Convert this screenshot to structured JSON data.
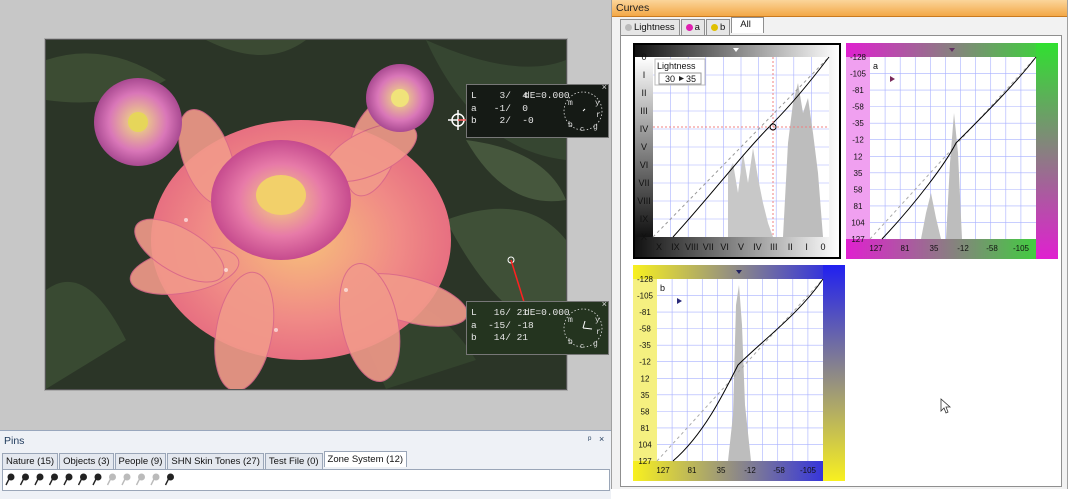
{
  "readouts": [
    {
      "L": "L    3/  4",
      "a": "a   -1/  0",
      "b": "b    2/  -0",
      "dE": "dE=0.000",
      "close": "×"
    },
    {
      "L": "L   16/ 21",
      "a": "a  -15/ -18",
      "b": "b   14/ 21",
      "dE": "dE=0.000",
      "close": "×"
    }
  ],
  "dial_labels": {
    "m": "m",
    "y": "y",
    "r": "r",
    "g": "g",
    "b": "b",
    "c": "c"
  },
  "pins": {
    "title": "Pins",
    "pin_control": "ᵖ",
    "close_control": "×",
    "tabs": [
      "Nature (15)",
      "Objects (3)",
      "People (9)",
      "SHN Skin Tones (27)",
      "Test File (0)",
      "Zone System (12)"
    ],
    "active_tab": 5
  },
  "curves": {
    "title": "Curves",
    "tabs": [
      "Lightness",
      "a",
      "b",
      "All"
    ],
    "tab_colors": [
      "#c0c0c0",
      "#e020b0",
      "#e0c000",
      ""
    ],
    "lightness": {
      "label": "Lightness",
      "input": "30",
      "output": "35",
      "left_ticks": [
        "0",
        "I",
        "II",
        "III",
        "IV",
        "V",
        "VI",
        "VII",
        "VIII",
        "IX",
        "X"
      ],
      "bottom_ticks": [
        "X",
        "IX",
        "VIII",
        "VII",
        "VI",
        "V",
        "IV",
        "III",
        "II",
        "I",
        "0"
      ]
    },
    "a_curve": {
      "label": "a",
      "left_ticks": [
        "-128",
        "-105",
        "-81",
        "-58",
        "-35",
        "-12",
        "12",
        "35",
        "58",
        "81",
        "104",
        "127"
      ],
      "bottom_ticks": [
        "127",
        "81",
        "35",
        "-12",
        "-58",
        "-105"
      ]
    },
    "b_curve": {
      "label": "b",
      "left_ticks": [
        "-128",
        "-105",
        "-81",
        "-58",
        "-35",
        "-12",
        "12",
        "35",
        "58",
        "81",
        "104",
        "127"
      ],
      "bottom_ticks": [
        "127",
        "81",
        "35",
        "-12",
        "-58",
        "-105"
      ]
    }
  }
}
